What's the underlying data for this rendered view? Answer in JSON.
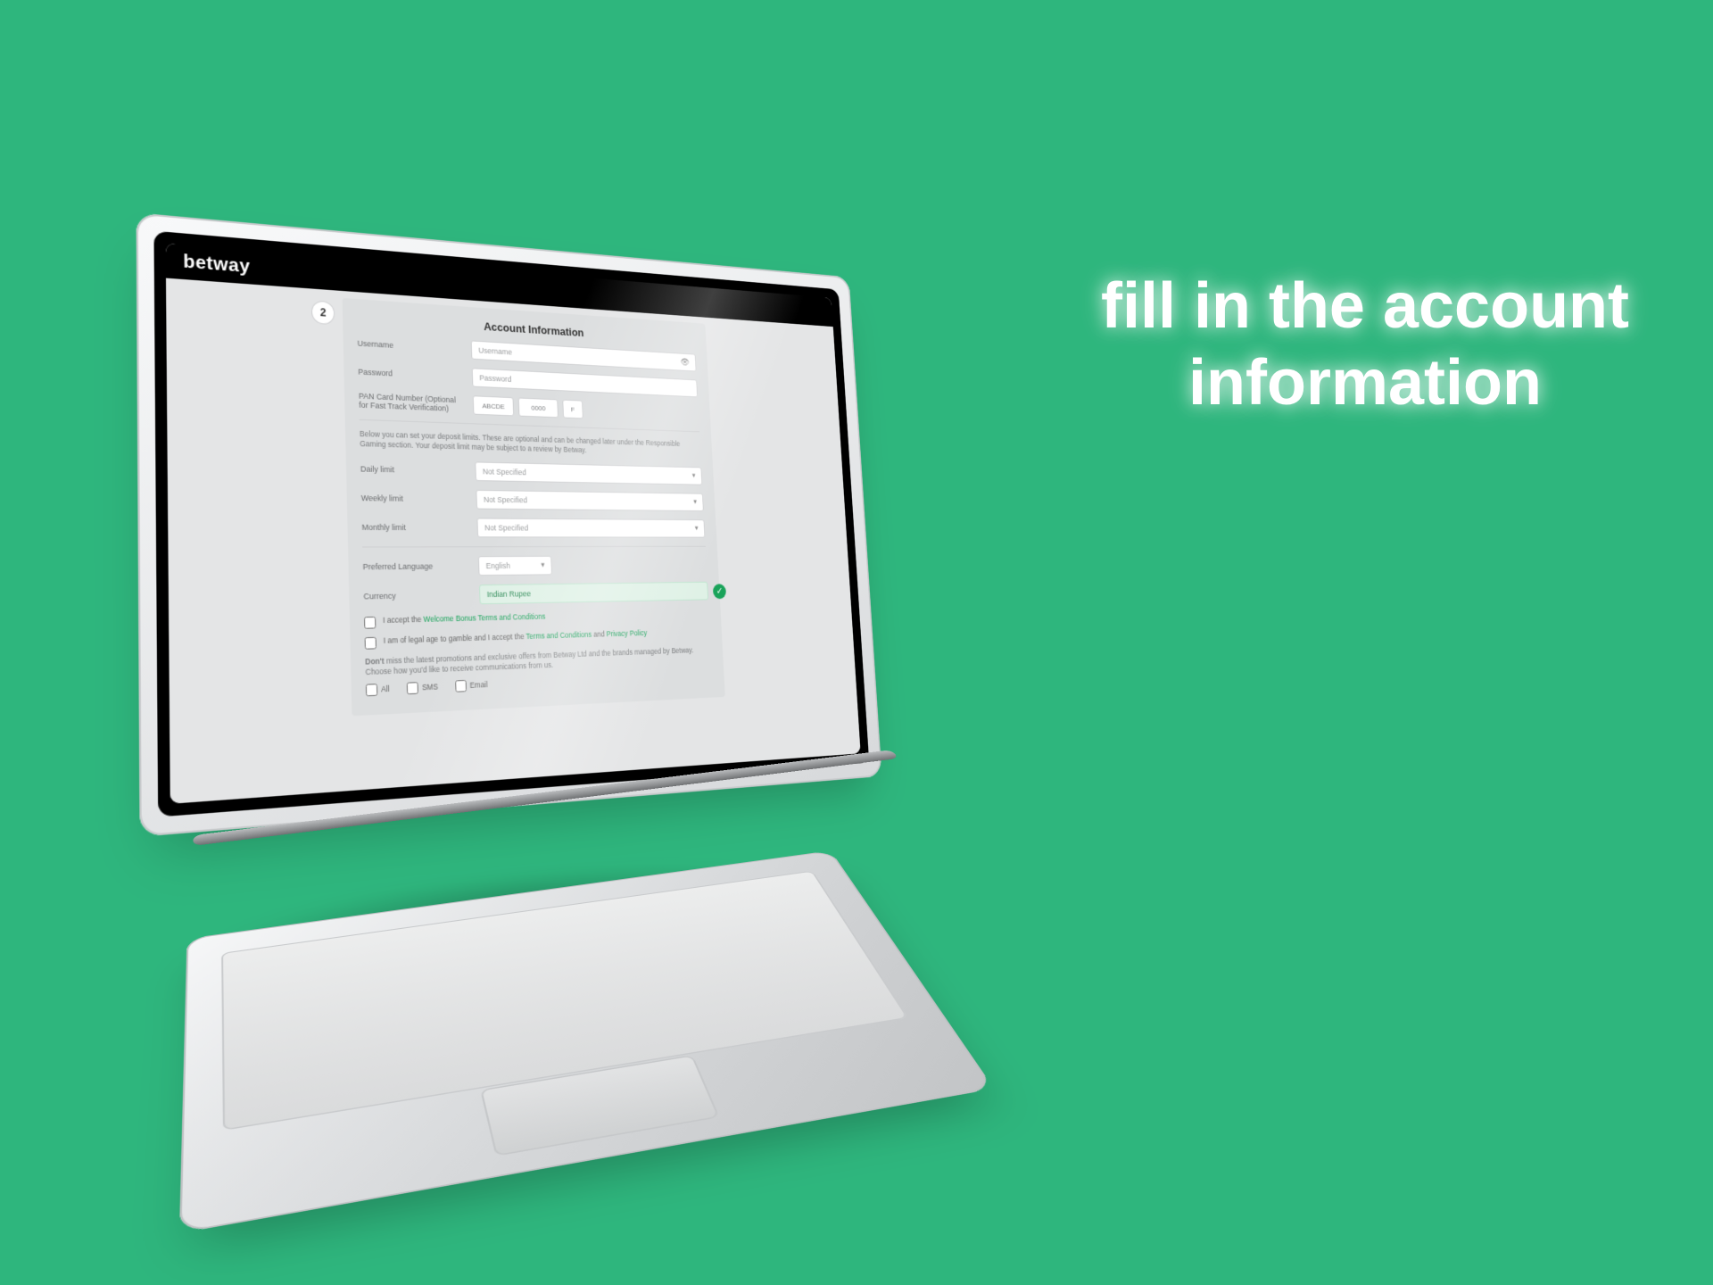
{
  "headline": "fill in the account information",
  "brand": "betway",
  "form": {
    "title": "Account Information",
    "step": "2",
    "username": {
      "label": "Username",
      "placeholder": "Username"
    },
    "password": {
      "label": "Password",
      "placeholder": "Password"
    },
    "pan": {
      "label": "PAN Card Number (Optional for Fast Track Verification)",
      "seg1": "ABCDE",
      "seg2": "0000",
      "seg3": "F"
    },
    "depositNote": "Below you can set your deposit limits. These are optional and can be changed later under the Responsible Gaming section. Your deposit limit may be subject to a review by Betway.",
    "daily": {
      "label": "Daily limit",
      "value": "Not Specified"
    },
    "weekly": {
      "label": "Weekly limit",
      "value": "Not Specified"
    },
    "monthly": {
      "label": "Monthly limit",
      "value": "Not Specified"
    },
    "language": {
      "label": "Preferred Language",
      "value": "English"
    },
    "currency": {
      "label": "Currency",
      "value": "Indian Rupee"
    },
    "chk1": {
      "pre": "I accept the ",
      "link": "Welcome Bonus Terms and Conditions"
    },
    "chk2": {
      "pre": "I am of legal age to gamble and I accept the ",
      "link1": "Terms and Conditions",
      "mid": " and ",
      "link2": "Privacy Policy"
    },
    "commNote": {
      "bold": "Don't",
      "rest": " miss the latest promotions and exclusive offers from Betway Ltd and the brands managed by Betway. Choose how you'd like to receive communications from us."
    },
    "comm": {
      "all": "All",
      "sms": "SMS",
      "email": "Email"
    }
  }
}
